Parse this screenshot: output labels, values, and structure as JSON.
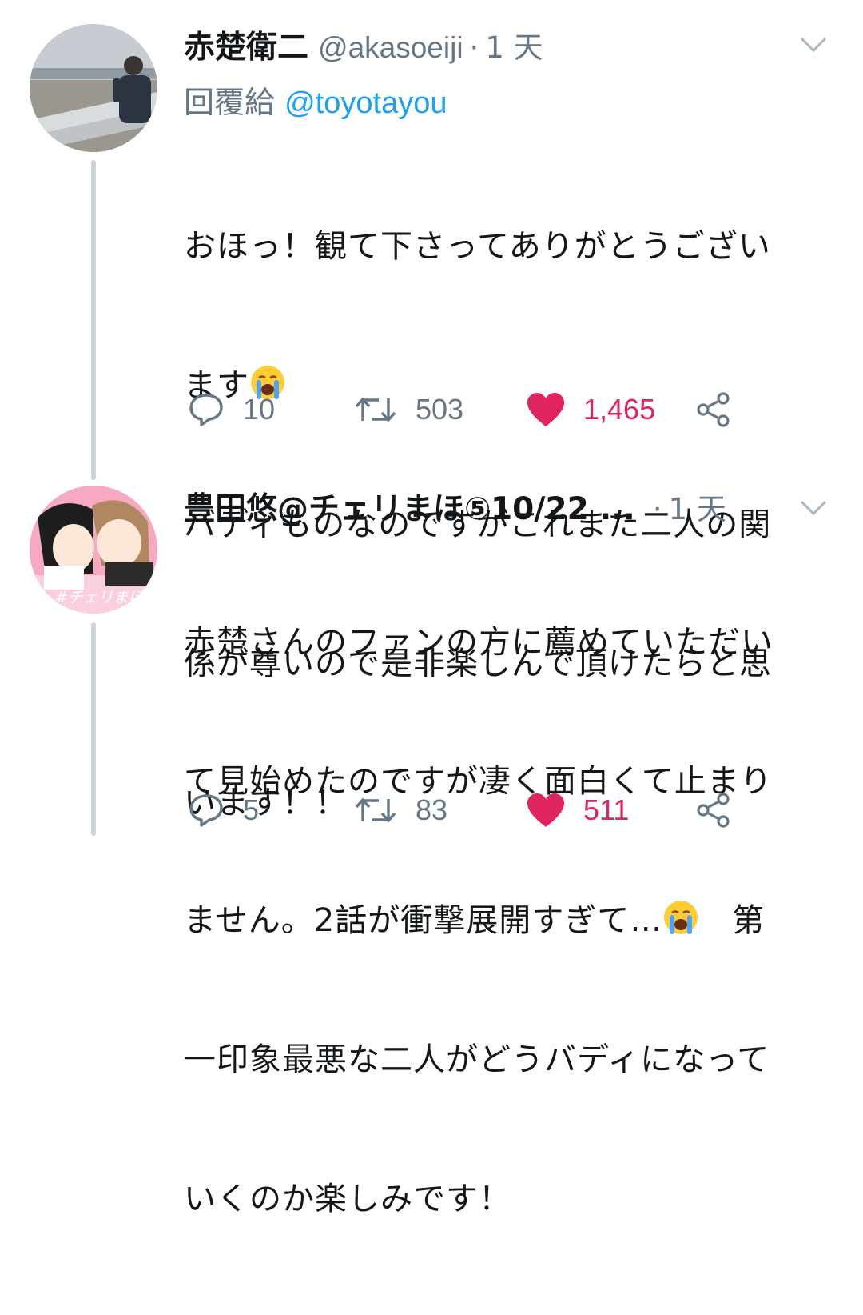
{
  "tweets": [
    {
      "author_name": "赤楚衛二",
      "handle": "@akasoeiji",
      "separator": "·",
      "time": "1 天",
      "reply_prefix": "回覆給",
      "reply_to": "@toyotayou",
      "lines": [
        "おほっ！観て下さってありがとうござい",
        "ます",
        "バディものなのですがこれまた二人の関",
        "係が尊いので是非楽しんで頂けたらと思",
        "います！！"
      ],
      "reply_icon": "reply-icon",
      "replies": "10",
      "retweets": "503",
      "likes": "1,465",
      "liked": true
    },
    {
      "author_name": "豊田悠@チェリまほ⑤10/22 ...",
      "separator": "·",
      "time": "1 天",
      "avatar_text": "#チェリまほ",
      "lines": [
        "赤楚さんのファンの方に薦めていただい",
        "て見始めたのですが凄く面白くて止まり",
        "ません。2話が衝撃展開すぎて…",
        "　第",
        "一印象最悪な二人がどうバディになって",
        "いくのか楽しみです！"
      ],
      "replies": "5",
      "retweets": "83",
      "likes": "511",
      "liked": true
    }
  ],
  "colors": {
    "like": "#e0245e",
    "link": "#1da1f2",
    "muted": "#657786",
    "thread_line": "#ccd6dd"
  },
  "icons": [
    "chevron-down-icon",
    "reply-icon",
    "retweet-icon",
    "heart-icon",
    "share-icon",
    "crying-face-emoji"
  ]
}
